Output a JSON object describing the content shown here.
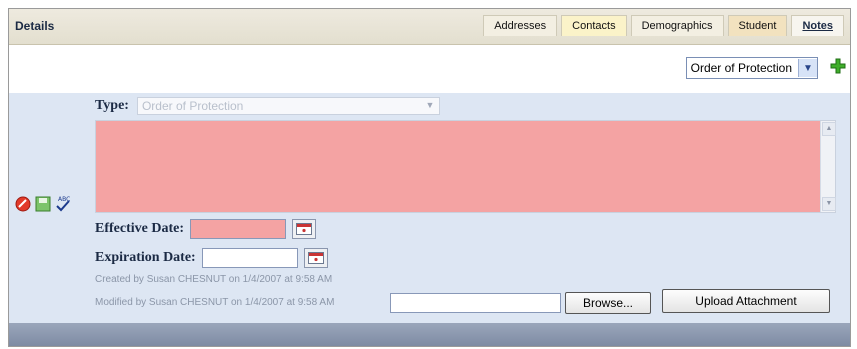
{
  "header": {
    "title": "Details",
    "tabs": [
      {
        "label": "Addresses"
      },
      {
        "label": "Contacts"
      },
      {
        "label": "Demographics"
      },
      {
        "label": "Student"
      },
      {
        "label": "Notes"
      }
    ]
  },
  "toolbar": {
    "note_type_selected": "Order of Protection",
    "add_icon": "add-plus-icon"
  },
  "note": {
    "type_label": "Type:",
    "type_value": "Order of Protection",
    "effective_date_label": "Effective Date:",
    "effective_date_value": "",
    "expiration_date_label": "Expiration Date:",
    "expiration_date_value": "",
    "created_text": "Created by Susan CHESNUT on 1/4/2007 at 9:58 AM",
    "modified_text": "Modified by Susan CHESNUT on 1/4/2007 at 9:58 AM",
    "browse_label": "Browse...",
    "upload_label": "Upload Attachment",
    "icons": [
      "delete-icon",
      "save-icon",
      "spellcheck-icon"
    ]
  },
  "colors": {
    "required_field": "#f4a3a3",
    "panel": "#dde6f3",
    "header_bg": "#e8e4d6"
  }
}
